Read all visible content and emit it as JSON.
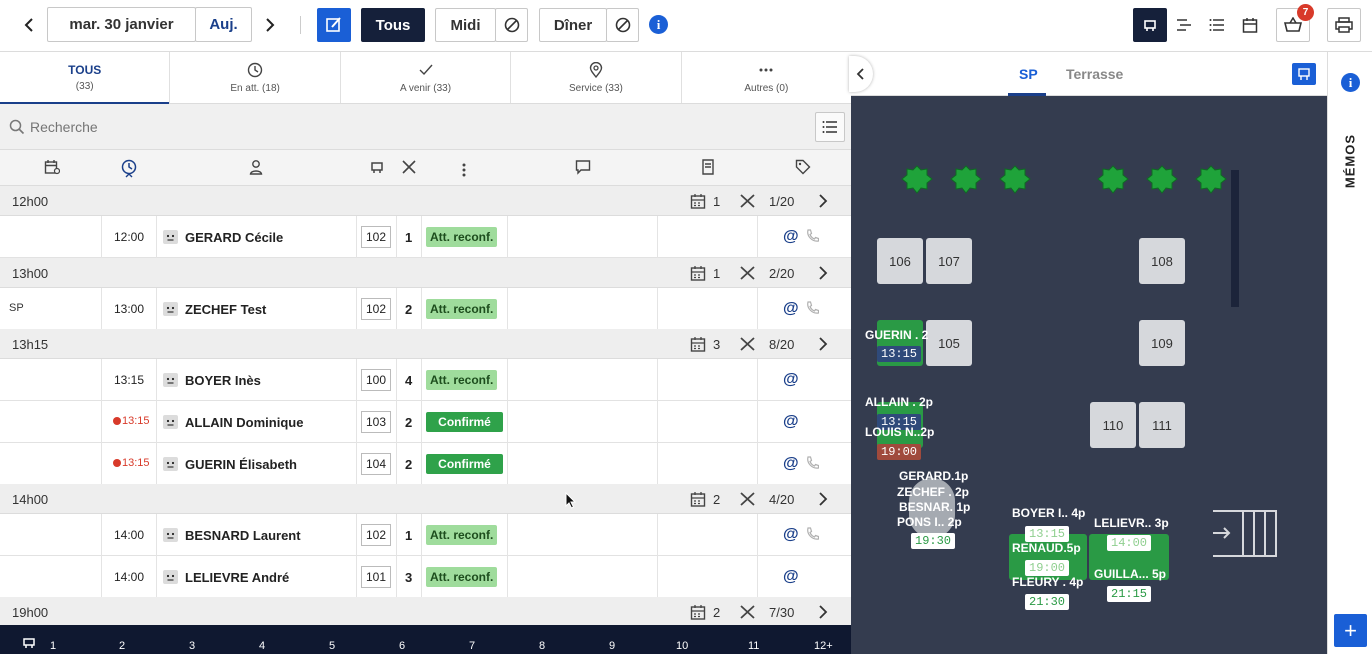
{
  "header": {
    "date_label": "mar. 30 janvier",
    "today_label": "Auj.",
    "service_all": "Tous",
    "service_lunch": "Midi",
    "service_dinner": "Dîner",
    "cart_badge": "7"
  },
  "tabs": [
    {
      "label": "TOUS",
      "count": "(33)"
    },
    {
      "label": "En att. (18)"
    },
    {
      "label": "A venir (33)"
    },
    {
      "label": "Service (33)"
    },
    {
      "label": "Autres (0)"
    }
  ],
  "search": {
    "placeholder": "Recherche"
  },
  "groups": [
    {
      "time": "12h00",
      "count": "1",
      "ratio": "1/20"
    },
    {
      "time": "13h00",
      "count": "1",
      "ratio": "2/20"
    },
    {
      "time": "13h15",
      "count": "3",
      "ratio": "8/20"
    },
    {
      "time": "14h00",
      "count": "2",
      "ratio": "4/20"
    },
    {
      "time": "19h00",
      "count": "2",
      "ratio": "7/30"
    }
  ],
  "rows": [
    {
      "area": "",
      "time": "12:00",
      "name": "GERARD Cécile",
      "table": "102",
      "covers": "1",
      "status": "Att. reconf."
    },
    {
      "area": "SP",
      "time": "13:00",
      "name": "ZECHEF Test",
      "table": "102",
      "covers": "2",
      "status": "Att. reconf."
    },
    {
      "area": "",
      "time": "13:15",
      "name": "BOYER Inès",
      "table": "100",
      "covers": "4",
      "status": "Att. reconf."
    },
    {
      "area": "",
      "time": "13:15",
      "name": "ALLAIN Dominique",
      "table": "103",
      "covers": "2",
      "status": "Confirmé"
    },
    {
      "area": "",
      "time": "13:15",
      "name": "GUERIN Élisabeth",
      "table": "104",
      "covers": "2",
      "status": "Confirmé"
    },
    {
      "area": "",
      "time": "14:00",
      "name": "BESNARD Laurent",
      "table": "102",
      "covers": "1",
      "status": "Att. reconf."
    },
    {
      "area": "",
      "time": "14:00",
      "name": "LELIEVRE André",
      "table": "101",
      "covers": "3",
      "status": "Att. reconf."
    }
  ],
  "bottom_numbers": [
    "1",
    "2",
    "3",
    "4",
    "5",
    "6",
    "7",
    "8",
    "9",
    "10",
    "11",
    "12+"
  ],
  "plan": {
    "rooms": [
      "SP",
      "Terrasse"
    ],
    "tables": [
      "106",
      "107",
      "108",
      "105",
      "109",
      "110",
      "111"
    ],
    "labels": {
      "guerin": "GUERIN . 2",
      "guerin_time": "13:15",
      "allain": "ALLAIN . 2p",
      "allain_time": "13:15",
      "louis": "LOUIS N..2p",
      "louis_time": "19:00",
      "gerard": "GERARD.1p",
      "zechef": "ZECHEF . 2p",
      "besnard": "BESNAR. 1p",
      "pons": "PONS I.. 2p",
      "pons_time": "19:30",
      "boyer": "BOYER I.. 4p",
      "boyer_time": "13:15",
      "renaud": "RENAUD.5p",
      "renaud_time": "19:00",
      "fleury": "FLEURY . 4p",
      "fleury_time": "21:30",
      "lelievre": "LELIEVR.. 3p",
      "lelievre_time": "14:00",
      "guilla": "GUILLA... 5p",
      "guilla_time": "21:15"
    }
  },
  "memos_label": "MÉMOS"
}
